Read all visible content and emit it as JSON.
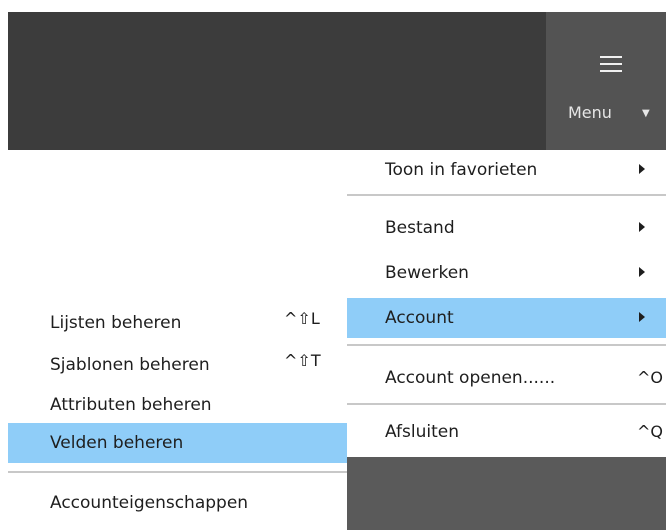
{
  "header": {
    "menu_label": "Menu",
    "menu_caret": "▼"
  },
  "main_menu": {
    "items": [
      {
        "label": "Toon in favorieten",
        "shortcut": "",
        "has_submenu": true,
        "highlighted": false
      },
      {
        "label": "Bestand",
        "shortcut": "",
        "has_submenu": true,
        "highlighted": false
      },
      {
        "label": "Bewerken",
        "shortcut": "",
        "has_submenu": true,
        "highlighted": false
      },
      {
        "label": "Account",
        "shortcut": "",
        "has_submenu": true,
        "highlighted": true
      },
      {
        "label": "Account openen......",
        "shortcut": "^O",
        "has_submenu": false,
        "highlighted": false
      },
      {
        "label": "Afsluiten",
        "shortcut": "^Q",
        "has_submenu": false,
        "highlighted": false
      }
    ]
  },
  "account_submenu": {
    "items": [
      {
        "label": "Lijsten beheren",
        "shortcut": "^⇧L",
        "highlighted": false
      },
      {
        "label": "Sjablonen beheren",
        "shortcut": "^⇧T",
        "highlighted": false
      },
      {
        "label": "Attributen beheren",
        "shortcut": "",
        "highlighted": false
      },
      {
        "label": "Velden beheren",
        "shortcut": "",
        "highlighted": true
      },
      {
        "label": "Accounteigenschappen",
        "shortcut": "",
        "highlighted": false
      }
    ]
  },
  "colors": {
    "toolbar_bg": "#3c3c3c",
    "menu_button_bg": "#535353",
    "highlight": "#8fcdf8",
    "menu_bg": "#ffffff",
    "separator": "#c8c8c8"
  }
}
